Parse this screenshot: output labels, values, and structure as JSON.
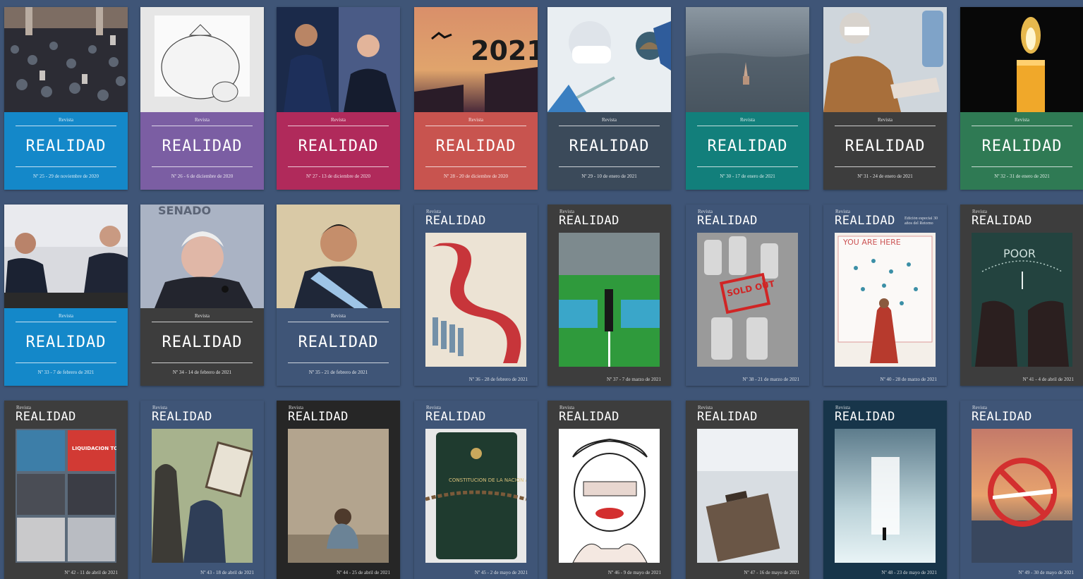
{
  "kicker": "Revista",
  "brand": "REALIDAD",
  "special_note": "Edición especial 30 años del Retorno",
  "covers": [
    {
      "issue": "Nº 25 - 29 de noviembre de 2020",
      "color": "#1488c9"
    },
    {
      "issue": "Nº 26 - 6 de diciembre de 2020",
      "color": "#7b5ea3"
    },
    {
      "issue": "Nº 27 - 13 de diciembre de 2020",
      "color": "#b02a5b"
    },
    {
      "issue": "Nº 28 - 20 de diciembre de 2020",
      "color": "#c8544f",
      "image_text": "2021"
    },
    {
      "issue": "Nº 29 - 10 de enero de 2021",
      "color": "#3b4a5a"
    },
    {
      "issue": "Nº 30 - 17 de enero de 2021",
      "color": "#127f7b"
    },
    {
      "issue": "Nº 31 - 24 de enero de 2021",
      "color": "#3d3d3d"
    },
    {
      "issue": "Nº 32 - 31 de enero de 2021",
      "color": "#2f7a54"
    },
    {
      "issue": "Nº 33 - 7 de febrero de 2021",
      "color": "#1488c9"
    },
    {
      "issue": "Nº 34 - 14 de febrero de 2021",
      "color": "#3d3d3d",
      "image_text": "SENADO"
    },
    {
      "issue": "Nº 35 - 21 de febrero de 2021",
      "color": "#3f5577"
    },
    {
      "issue": "Nº 36 - 28 de febrero de 2021",
      "color": "#3f5577"
    },
    {
      "issue": "Nº 37 - 7 de marzo de 2021",
      "color": "#3d3d3d"
    },
    {
      "issue": "Nº 38 - 21 de marzo de 2021",
      "color": "#3f5577",
      "image_text": "SOLD OUT"
    },
    {
      "issue": "Nº 40 - 28 de marzo de 2021",
      "color": "#3f5577",
      "image_text": "YOU ARE HERE"
    },
    {
      "issue": "Nº 41 - 4 de abril de 2021",
      "color": "#3d3d3d",
      "image_text": "POOR"
    },
    {
      "issue": "Nº 42 - 11 de abril de 2021",
      "color": "#3d3d3d",
      "image_text": "LIQUIDACION TOTAL"
    },
    {
      "issue": "Nº 43 - 18 de abril de 2021",
      "color": "#3f5577"
    },
    {
      "issue": "Nº 44 - 25 de abril de 2021",
      "color": "#262626"
    },
    {
      "issue": "Nº 45 - 2 de mayo de 2021",
      "color": "#3f5577",
      "image_text": "CONSTITUCION DE LA NACION ARGENTINA"
    },
    {
      "issue": "Nº 46 - 9 de mayo de 2021",
      "color": "#3d3d3d"
    },
    {
      "issue": "Nº 47 - 16 de mayo de 2021",
      "color": "#3d3d3d"
    },
    {
      "issue": "Nº 48 - 23 de mayo de 2021",
      "color": "#17354a"
    },
    {
      "issue": "Nº 49 - 30 de mayo de 2021",
      "color": "#3f5577"
    }
  ]
}
